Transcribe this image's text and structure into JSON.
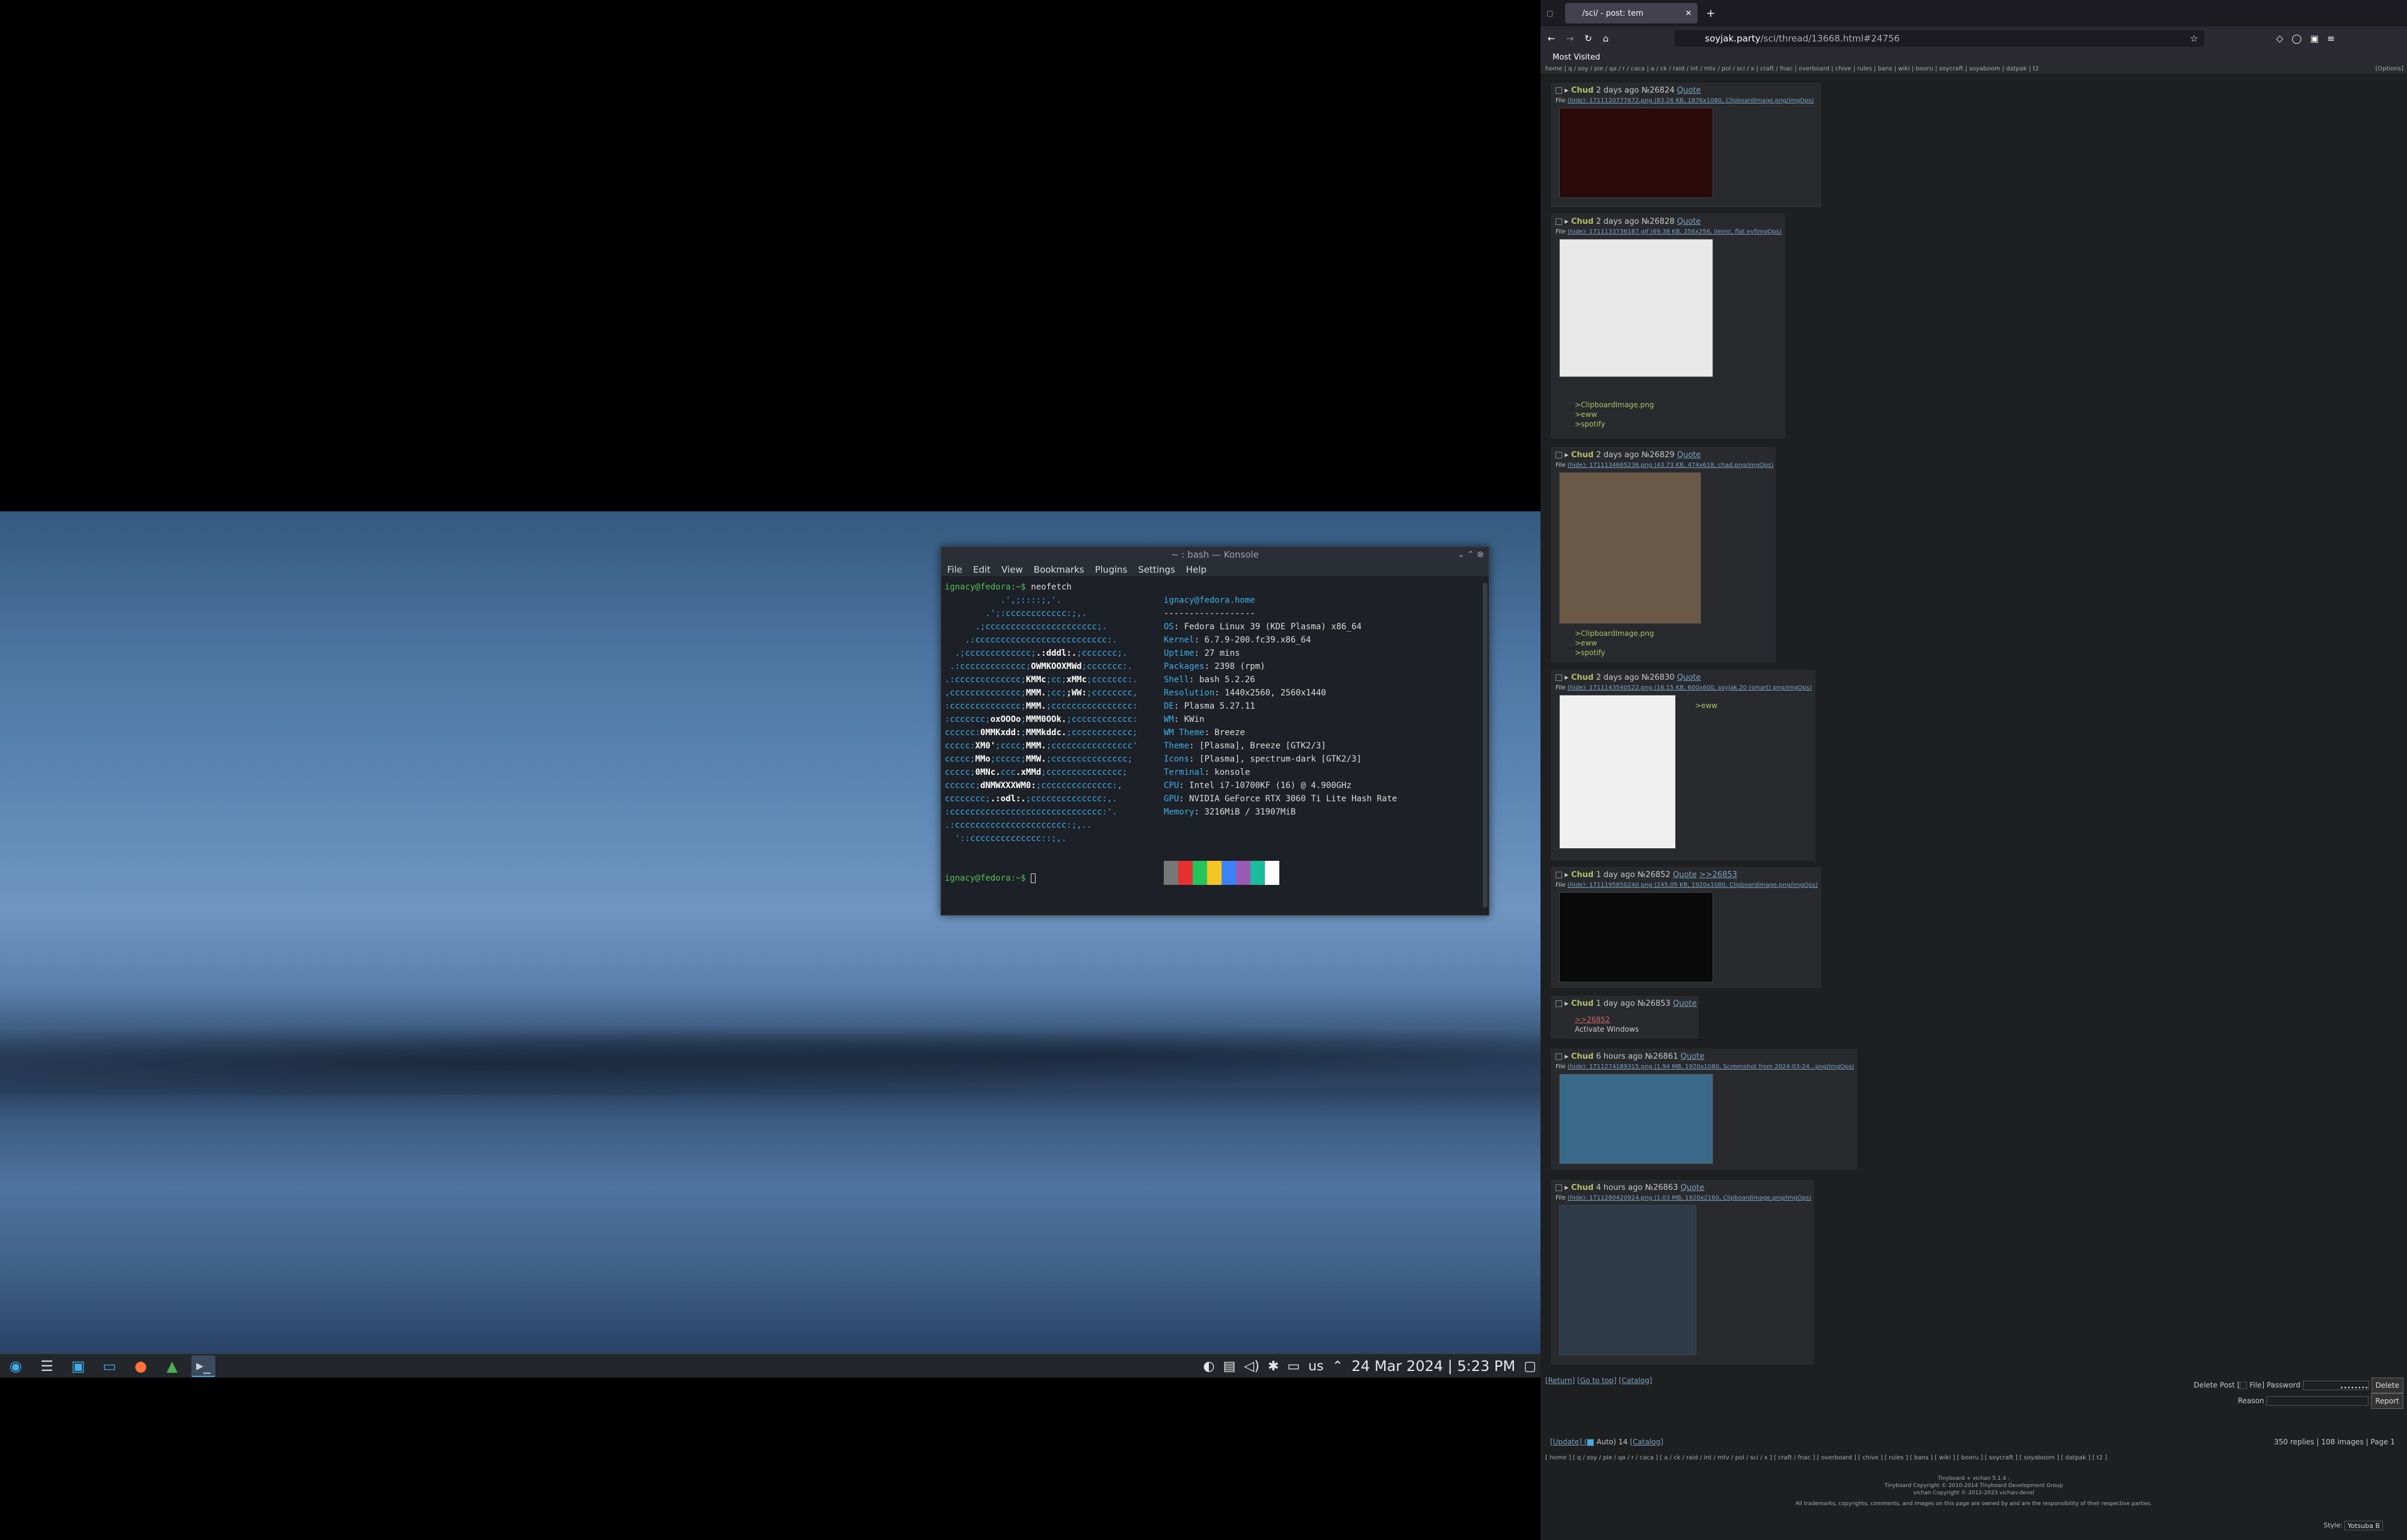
{
  "desktop": {
    "clock": "24 Mar 2024 | 5:23 PM",
    "keyboard": "us"
  },
  "konsole": {
    "title": "~ : bash — Konsole",
    "menu": [
      "File",
      "Edit",
      "View",
      "Bookmarks",
      "Plugins",
      "Settings",
      "Help"
    ],
    "prompt": "ignacy@fedora:~$",
    "command": "neofetch",
    "user_host": "ignacy@fedora.home",
    "separator": "------------------",
    "info": [
      [
        "OS",
        "Fedora Linux 39 (KDE Plasma) x86_64"
      ],
      [
        "Kernel",
        "6.7.9-200.fc39.x86_64"
      ],
      [
        "Uptime",
        "27 mins"
      ],
      [
        "Packages",
        "2398 (rpm)"
      ],
      [
        "Shell",
        "bash 5.2.26"
      ],
      [
        "Resolution",
        "1440x2560, 2560x1440"
      ],
      [
        "DE",
        "Plasma 5.27.11"
      ],
      [
        "WM",
        "KWin"
      ],
      [
        "WM Theme",
        "Breeze"
      ],
      [
        "Theme",
        "[Plasma], Breeze [GTK2/3]"
      ],
      [
        "Icons",
        "[Plasma], spectrum-dark [GTK2/3]"
      ],
      [
        "Terminal",
        "konsole"
      ],
      [
        "CPU",
        "Intel i7-10700KF (16) @ 4.900GHz"
      ],
      [
        "GPU",
        "NVIDIA GeForce RTX 3060 Ti Lite Hash Rate"
      ],
      [
        "Memory",
        "3216MiB / 31907MiB"
      ]
    ],
    "colors": [
      "#777777",
      "#e5302f",
      "#22c55e",
      "#f3c623",
      "#3b82f6",
      "#9b59b6",
      "#1abc9c",
      "#ffffff"
    ]
  },
  "browser": {
    "tab_title": "/sci/ - post: tem",
    "url_domain": "soyjak.party",
    "url_path": "/sci/thread/13668.html#24756",
    "bookmarks": "Most Visited",
    "boards": "home | q / soy / pie / qa / r / caca | a / ck / raid / int / mtv / pol / sci / x | craft / fnac | overboard | chive | rules | bans | wiki | booru | soycraft | soyaboom | datpak | t2",
    "options": "[Options]"
  },
  "posts": [
    {
      "name": "Chud",
      "time": "2 days ago",
      "no": "№26824",
      "quote": "Quote",
      "file": "(hide): 1711120777672.png (83.26 KB, 1876x1080, Clipboardimage.png/imgOps)",
      "text": []
    },
    {
      "name": "Chud",
      "time": "2 days ago",
      "no": "№26828",
      "quote": "Quote",
      "file": "(hide): 1711133736187.gif (69.38 KB, 256x256, ilemir, flat eyfimgOps)",
      "text": [
        ">ClipboardImage.png",
        ">eww",
        ">spotify"
      ]
    },
    {
      "name": "Chud",
      "time": "2 days ago",
      "no": "№26829",
      "quote": "Quote",
      "file": "(hide): 1711134665236.png (43.73 KB, 474x618, chad.png/imgOps)",
      "text": [
        ">ClipboardImage.png",
        ">eww",
        ">spotify"
      ]
    },
    {
      "name": "Chud",
      "time": "2 days ago",
      "no": "№26830",
      "quote": "Quote",
      "file": "(hide): 1711143540522.png (16.15 KB, 600x600, soyjak.20 (smart) png/imgOps)",
      "text": [
        ">eww"
      ]
    },
    {
      "name": "Chud",
      "time": "1 day ago",
      "no": "№26852",
      "quote": "Quote",
      "reply": ">>26853",
      "file": "(hide): 1711195850240.png (245.05 KB, 1920x1080, Clipboardimage.png/imgOps)",
      "text": []
    },
    {
      "name": "Chud",
      "time": "1 day ago",
      "no": "№26853",
      "quote": "Quote",
      "file": "",
      "text": [
        ">>26852",
        "Activate Windows"
      ]
    },
    {
      "name": "Chud",
      "time": "6 hours ago",
      "no": "№26861",
      "quote": "Quote",
      "file": "(hide): 1711274189315.png (1.94 MB, 1920x1080, Screenshot from 2024-03-24...png/imgOps)",
      "text": []
    },
    {
      "name": "Chud",
      "time": "4 hours ago",
      "no": "№26863",
      "quote": "Quote",
      "file": "(hide): 1711280420924.png (1.03 MB, 1920x2160, Clipboardimage.png/imgOps)",
      "text": []
    }
  ],
  "footer": {
    "nav": [
      "[Return]",
      "[Go to top]",
      "[Catalog]"
    ],
    "delete_label": "Delete Post [",
    "file_label": "File] Password",
    "password": "••••••••",
    "delete_btn": "Delete",
    "reason_label": "Reason",
    "report_btn": "Report",
    "update": "[Update] (",
    "auto": "Auto) 14",
    "catalog": "[Catalog]",
    "stats": "350 replies | 108 images | Page 1",
    "boards": "[ home ] [ q / soy / pie / qa / r / caca ] [ a / ck / raid / int / mtv / pol / sci / x ] [ craft / fnac ] [ overboard ] [ chive ] [ rules ] [ bans ] [ wiki ] [ booru ] [ soycraft ] [ soyaboom ] [ datpak ] [ t2 ]",
    "credit1": "Tinyboard + vichan 5.1.4 -",
    "credit2": "Tinyboard Copyright © 2010-2014 Tinyboard Development Group",
    "credit3": "vichan Copyright © 2012-2023 vichan-devel",
    "disclaimer": "All trademarks, copyrights, comments, and images on this page are owned by and are the responsibility of their respective parties.",
    "style_label": "Style:",
    "style_value": "Yotsuba B"
  }
}
